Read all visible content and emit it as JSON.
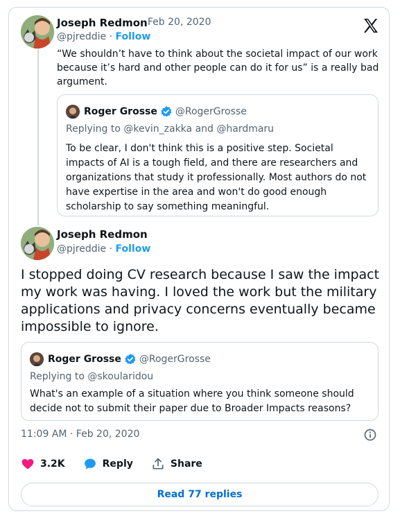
{
  "tweet": {
    "author": {
      "name": "Joseph Redmon",
      "handle": "@pjreddie",
      "follow_label": "Follow"
    },
    "date": "· Feb 20, 2020",
    "text": "“We shouldn’t have to think about the societal impact of our work because it’s hard and other people can do it for us” is a really bad argument.",
    "quote": {
      "name": "Roger Grosse",
      "handle": "@RogerGrosse",
      "replying": "Replying to @kevin_zakka and @hardmaru",
      "text": "To be clear, I don't think this is a positive step. Societal impacts of AI is a tough field, and there are researchers and organizations that study it professionally. Most authors do not have expertise in the area and won't do good enough scholarship to say something meaningful."
    }
  },
  "reply": {
    "author": {
      "name": "Joseph Redmon",
      "handle": "@pjreddie",
      "follow_label": "Follow"
    },
    "text": "I stopped doing CV research because I saw the impact my work was having. I loved the work but the military applications and privacy concerns eventually became impossible to ignore.",
    "quote": {
      "name": "Roger Grosse",
      "handle": "@RogerGrosse",
      "replying": "Replying to @skoularidou",
      "text": "What's an example of a situation where you think someone should decide not to submit their paper due to Broader Impacts reasons?"
    },
    "timestamp": "11:09 AM · Feb 20, 2020",
    "actions": {
      "likes": "3.2K",
      "reply_label": "Reply",
      "share_label": "Share"
    },
    "read_replies": "Read 77 replies"
  },
  "icons": {
    "logo": "x-logo-icon",
    "verified": "verified-badge-icon",
    "info": "info-icon",
    "like": "heart-icon",
    "reply": "speech-bubble-icon",
    "share": "share-icon"
  },
  "colors": {
    "accent": "#1d9bf0",
    "like": "#f91880",
    "link": "#006fd6",
    "secondary": "#536471"
  }
}
